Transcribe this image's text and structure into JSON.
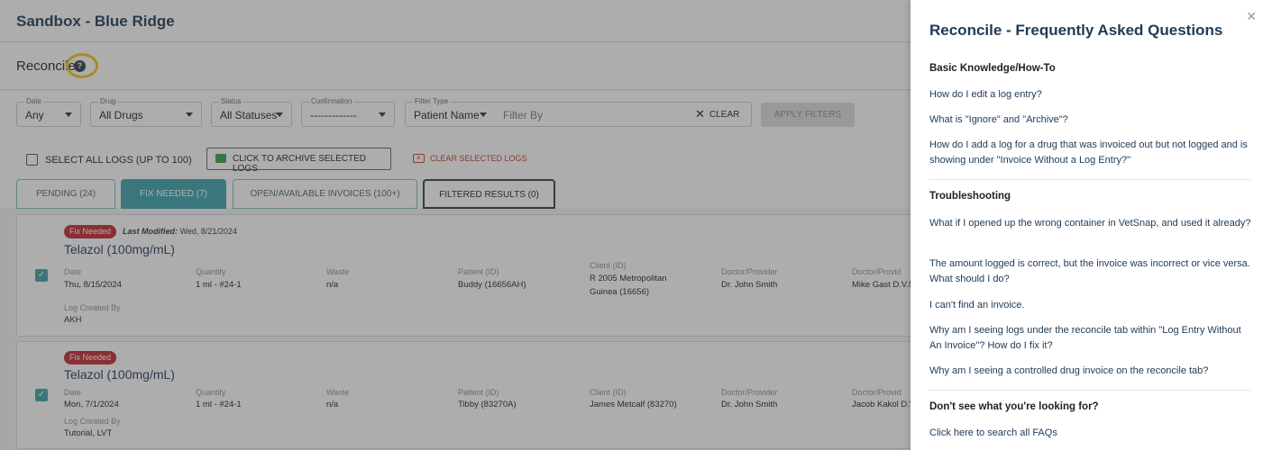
{
  "app": {
    "title": "Sandbox - Blue Ridge"
  },
  "page": {
    "title": "Reconcile",
    "help_icon": "question-circle-icon"
  },
  "filters": {
    "date": {
      "label": "Date",
      "value": "Any"
    },
    "drug": {
      "label": "Drug",
      "value": "All Drugs"
    },
    "status": {
      "label": "Status",
      "value": "All Statuses"
    },
    "confirmation": {
      "label": "Confirmation",
      "value": "-------------"
    },
    "filter_type": {
      "label": "Filter Type",
      "value": "Patient Name"
    },
    "filter_by": {
      "placeholder": "Filter By"
    },
    "clear_label": "CLEAR",
    "apply_label": "APPLY FILTERS"
  },
  "bulk": {
    "select_all_label": "SELECT ALL LOGS (UP TO 100)",
    "archive_label": "CLICK TO ARCHIVE SELECTED LOGS",
    "clear_selected_label": "CLEAR SELECTED LOGS"
  },
  "tabs": [
    {
      "label": "PENDING (24)"
    },
    {
      "label": "FIX NEEDED (7)"
    },
    {
      "label": "OPEN/AVAILABLE INVOICES (100+)"
    },
    {
      "label": "FILTERED RESULTS (0)"
    }
  ],
  "columns": {
    "date": "Date",
    "quantity": "Quantity",
    "waste": "Waste",
    "patient": "Patient (ID)",
    "client": "Client (ID)",
    "doctor": "Doctor/Provider",
    "doctor2": "Doctor/Provid",
    "log_created_by": "Log Created By"
  },
  "logs": [
    {
      "badge": "Fix Needed",
      "last_modified_label": "Last Modified:",
      "last_modified": "Wed, 8/21/2024",
      "drug": "Telazol (100mg/mL)",
      "date": "Thu, 8/15/2024",
      "quantity": "1 ml - #24-1",
      "waste": "n/a",
      "patient": "Buddy (16656AH)",
      "client_line1": "R 2005 Metropolitan",
      "client_line2": "Guinea (16656)",
      "doctor": "Dr. John Smith",
      "doctor2": "Mike Gast D.V.M",
      "created_by": "AKH"
    },
    {
      "badge": "Fix Needed",
      "drug": "Telazol (100mg/mL)",
      "date": "Mon, 7/1/2024",
      "quantity": "1 ml - #24-1",
      "waste": "n/a",
      "patient": "Tibby (83270A)",
      "client_line1": "James Metcalf (83270)",
      "doctor": "Dr. John Smith",
      "doctor2": "Jacob Kakol D.V.",
      "created_by": "Tutorial, LVT"
    }
  ],
  "faq": {
    "title": "Reconcile - Frequently Asked Questions",
    "close_icon": "close-icon",
    "sections": [
      {
        "heading": "Basic Knowledge/How-To",
        "questions": [
          "How do I edit a log entry?",
          "What is \"Ignore\" and \"Archive\"?",
          "How do I add a log for a drug that was invoiced out but not logged and is showing under \"Invoice Without a Log Entry?\""
        ]
      },
      {
        "heading": "Troubleshooting",
        "questions": [
          "What if I opened up the wrong container in VetSnap, and used it already?",
          "The amount logged is correct, but the invoice was incorrect or vice versa. What should I do?",
          "I can't find an invoice.",
          "Why am I seeing logs under the reconcile tab within \"Log Entry Without An Invoice\"? How do I fix it?",
          "Why am I seeing a controlled drug invoice on the reconcile tab?"
        ]
      }
    ],
    "footer_heading": "Don't see what you're looking for?",
    "footer_link": "Click here to search all FAQs"
  }
}
